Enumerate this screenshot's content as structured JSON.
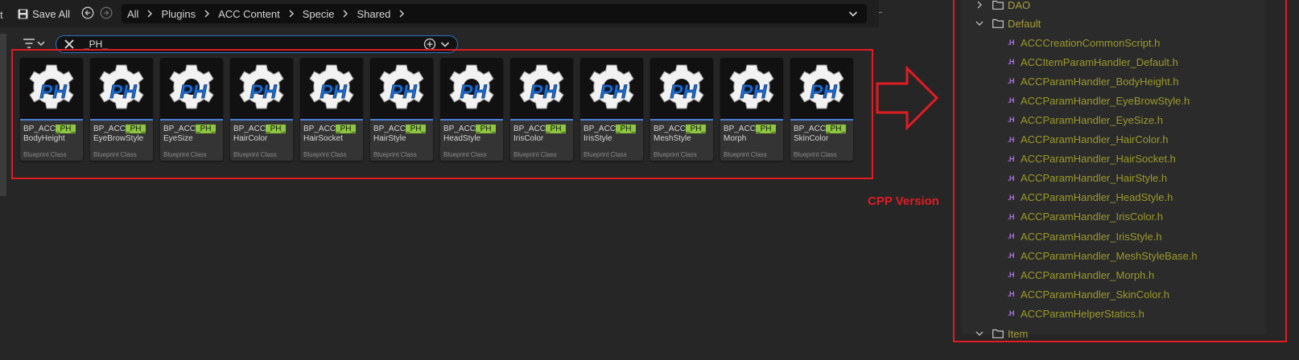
{
  "toolbar": {
    "edge_glyph": "t",
    "save_all_label": "Save All",
    "breadcrumbs": [
      "All",
      "Plugins",
      "ACC Content",
      "Specie",
      "Shared"
    ]
  },
  "search": {
    "value": "_PH_"
  },
  "assets": [
    {
      "prefix": "BP_ACC",
      "highlight": "_PH_",
      "suffix": "BodyHeight",
      "class": "Blueprint Class",
      "thumb_text": "PH"
    },
    {
      "prefix": "BP_ACC",
      "highlight": "_PH_",
      "suffix": "EyeBrowStyle",
      "class": "Blueprint Class",
      "thumb_text": "PH"
    },
    {
      "prefix": "BP_ACC",
      "highlight": "_PH_",
      "suffix": "EyeSize",
      "class": "Blueprint Class",
      "thumb_text": "PH"
    },
    {
      "prefix": "BP_ACC",
      "highlight": "_PH_",
      "suffix": "HairColor",
      "class": "Blueprint Class",
      "thumb_text": "PH"
    },
    {
      "prefix": "BP_ACC",
      "highlight": "_PH_",
      "suffix": "HairSocket",
      "class": "Blueprint Class",
      "thumb_text": "PH"
    },
    {
      "prefix": "BP_ACC",
      "highlight": "_PH_",
      "suffix": "HairStyle",
      "class": "Blueprint Class",
      "thumb_text": "PH"
    },
    {
      "prefix": "BP_ACC",
      "highlight": "_PH_",
      "suffix": "HeadStyle",
      "class": "Blueprint Class",
      "thumb_text": "PH"
    },
    {
      "prefix": "BP_ACC",
      "highlight": "_PH_",
      "suffix": "IrisColor",
      "class": "Blueprint Class",
      "thumb_text": "PH"
    },
    {
      "prefix": "BP_ACC",
      "highlight": "_PH_",
      "suffix": "IrisStyle",
      "class": "Blueprint Class",
      "thumb_text": "PH"
    },
    {
      "prefix": "BP_ACC",
      "highlight": "_PH_",
      "suffix": "MeshStyle",
      "class": "Blueprint Class",
      "thumb_text": "PH"
    },
    {
      "prefix": "BP_ACC",
      "highlight": "_PH_",
      "suffix": "Morph",
      "class": "Blueprint Class",
      "thumb_text": "PH"
    },
    {
      "prefix": "BP_ACC",
      "highlight": "_PH_",
      "suffix": "SkinColor",
      "class": "Blueprint Class",
      "thumb_text": "PH"
    }
  ],
  "annotation": {
    "label": "CPP Version",
    "color": "#e11c23"
  },
  "tree": {
    "folders": [
      {
        "name": "DAO",
        "state": "collapsed"
      },
      {
        "name": "Default",
        "state": "expanded"
      },
      {
        "name": "Item",
        "state": "expanded"
      }
    ],
    "file_icon_text": ".H",
    "files": [
      "ACCCreationCommonScript.h",
      "ACCItemParamHandler_Default.h",
      "ACCParamHandler_BodyHeight.h",
      "ACCParamHandler_EyeBrowStyle.h",
      "ACCParamHandler_EyeSize.h",
      "ACCParamHandler_HairColor.h",
      "ACCParamHandler_HairSocket.h",
      "ACCParamHandler_HairStyle.h",
      "ACCParamHandler_HeadStyle.h",
      "ACCParamHandler_IrisColor.h",
      "ACCParamHandler_IrisStyle.h",
      "ACCParamHandler_MeshStyleBase.h",
      "ACCParamHandler_Morph.h",
      "ACCParamHandler_SkinColor.h",
      "ACCParamHelperStatics.h"
    ]
  },
  "colors": {
    "highlight": "#8dc63f",
    "file_name": "#9a9a2a",
    "header_icon": "#b073e6",
    "selection_bar": "#4a7fd8"
  }
}
